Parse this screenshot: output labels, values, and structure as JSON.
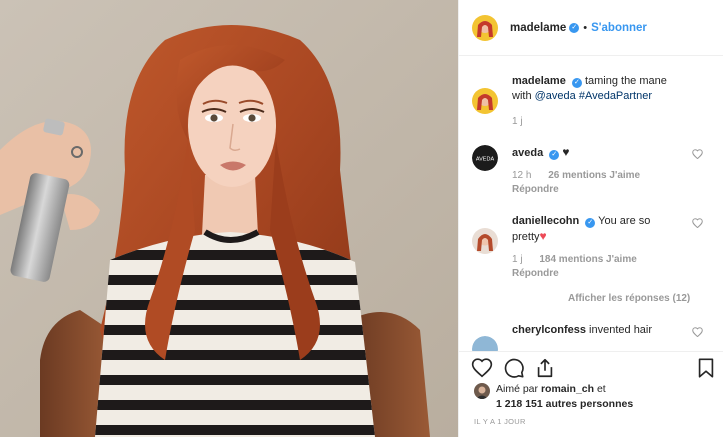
{
  "post": {
    "author": "madelame",
    "follow_label": "S'abonner",
    "separator": "•"
  },
  "caption": {
    "user": "madelame",
    "text": "taming the mane with",
    "mention": "@aveda",
    "hashtag": "#AvedaPartner",
    "time": "1 j"
  },
  "comments": [
    {
      "user": "aveda",
      "avatar_text": "AVEDA",
      "time": "12 h",
      "likes": "26 mentions J'aime",
      "reply": "Répondre"
    },
    {
      "user": "daniellecohn",
      "text_a": "You are so",
      "text_b": "pretty",
      "time": "1 j",
      "likes": "184 mentions J'aime",
      "reply": "Répondre"
    },
    {
      "user": "cherylconfess",
      "text": "invented hair"
    }
  ],
  "view_replies": "Afficher les réponses (12)",
  "likes": {
    "prefix": "Aimé par",
    "user": "romain_ch",
    "conj": "et",
    "others": "1 218 151 autres personnes"
  },
  "timestamp": "IL Y A 1 JOUR",
  "colors": {
    "accent": "#3897f0",
    "hair": "#b5502a",
    "heart_red": "#ed4956"
  },
  "icons": [
    "heart-icon",
    "comment-icon",
    "share-icon",
    "bookmark-icon",
    "verified-badge-icon"
  ]
}
